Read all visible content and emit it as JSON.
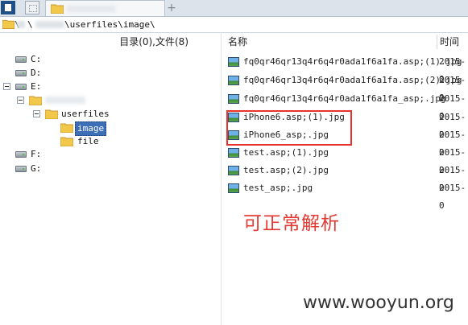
{
  "tab_bar": {
    "add_symbol": "+"
  },
  "address_bar": {
    "path_prefix": "\\",
    "path_mid": "\\",
    "path": "\\userfiles\\image\\"
  },
  "headers": {
    "tree_summary": "目录(0),文件(8)",
    "name": "名称",
    "time": "时间"
  },
  "tree": {
    "drives": [
      "C:",
      "D:",
      "E:",
      "F:",
      "G:"
    ],
    "userfiles": "userfiles",
    "image": "image",
    "file": "file"
  },
  "files": [
    {
      "name": "fq0qr46qr13q4r6q4r0ada1f6a1fa.asp;(1).jpg",
      "time": "2015-0"
    },
    {
      "name": "fq0qr46qr13q4r6q4r0ada1f6a1fa.asp;(2).jpg",
      "time": "2015-0"
    },
    {
      "name": "fq0qr46qr13q4r6q4r0ada1f6a1fa_asp;.jpg",
      "time": "2015-0"
    },
    {
      "name": "iPhone6.asp;(1).jpg",
      "time": "2015-0"
    },
    {
      "name": "iPhone6_asp;.jpg",
      "time": "2015-0"
    },
    {
      "name": "test.asp;(1).jpg",
      "time": "2015-0"
    },
    {
      "name": "test.asp;(2).jpg",
      "time": "2015-0"
    },
    {
      "name": "test_asp;.jpg",
      "time": "2015-0"
    }
  ],
  "annotation": "可正常解析",
  "watermark": "www.wooyun.org",
  "colors": {
    "highlight": "#e8322d",
    "selection": "#3d6fb6",
    "annotation": "#e03a33"
  },
  "icons": [
    "folder-icon",
    "drive-icon",
    "image-file-icon",
    "expand-collapse-icon"
  ]
}
